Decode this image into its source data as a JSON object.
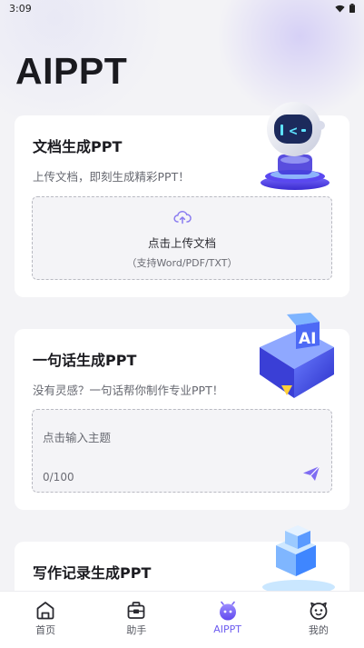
{
  "status_bar": {
    "time": "3:09"
  },
  "app_title": "AIPPT",
  "cards": {
    "doc": {
      "title": "文档生成PPT",
      "subtitle": "上传文档，即刻生成精彩PPT！",
      "upload_label": "点击上传文档",
      "upload_hint": "（支持Word/PDF/TXT）"
    },
    "sentence": {
      "title": "一句话生成PPT",
      "subtitle": "没有灵感？一句话帮你制作专业PPT！",
      "input_placeholder": "点击输入主题",
      "counter": "0/100"
    },
    "record": {
      "title": "写作记录生成PPT"
    }
  },
  "bottom_nav": {
    "items": [
      {
        "label": "首页",
        "icon": "home-icon",
        "active": false
      },
      {
        "label": "助手",
        "icon": "assistant-icon",
        "active": false
      },
      {
        "label": "AIPPT",
        "icon": "aippt-icon",
        "active": true
      },
      {
        "label": "我的",
        "icon": "profile-icon",
        "active": false
      }
    ]
  },
  "colors": {
    "accent": "#6e5ef0",
    "background": "#f3f3f6",
    "card": "#ffffff"
  }
}
